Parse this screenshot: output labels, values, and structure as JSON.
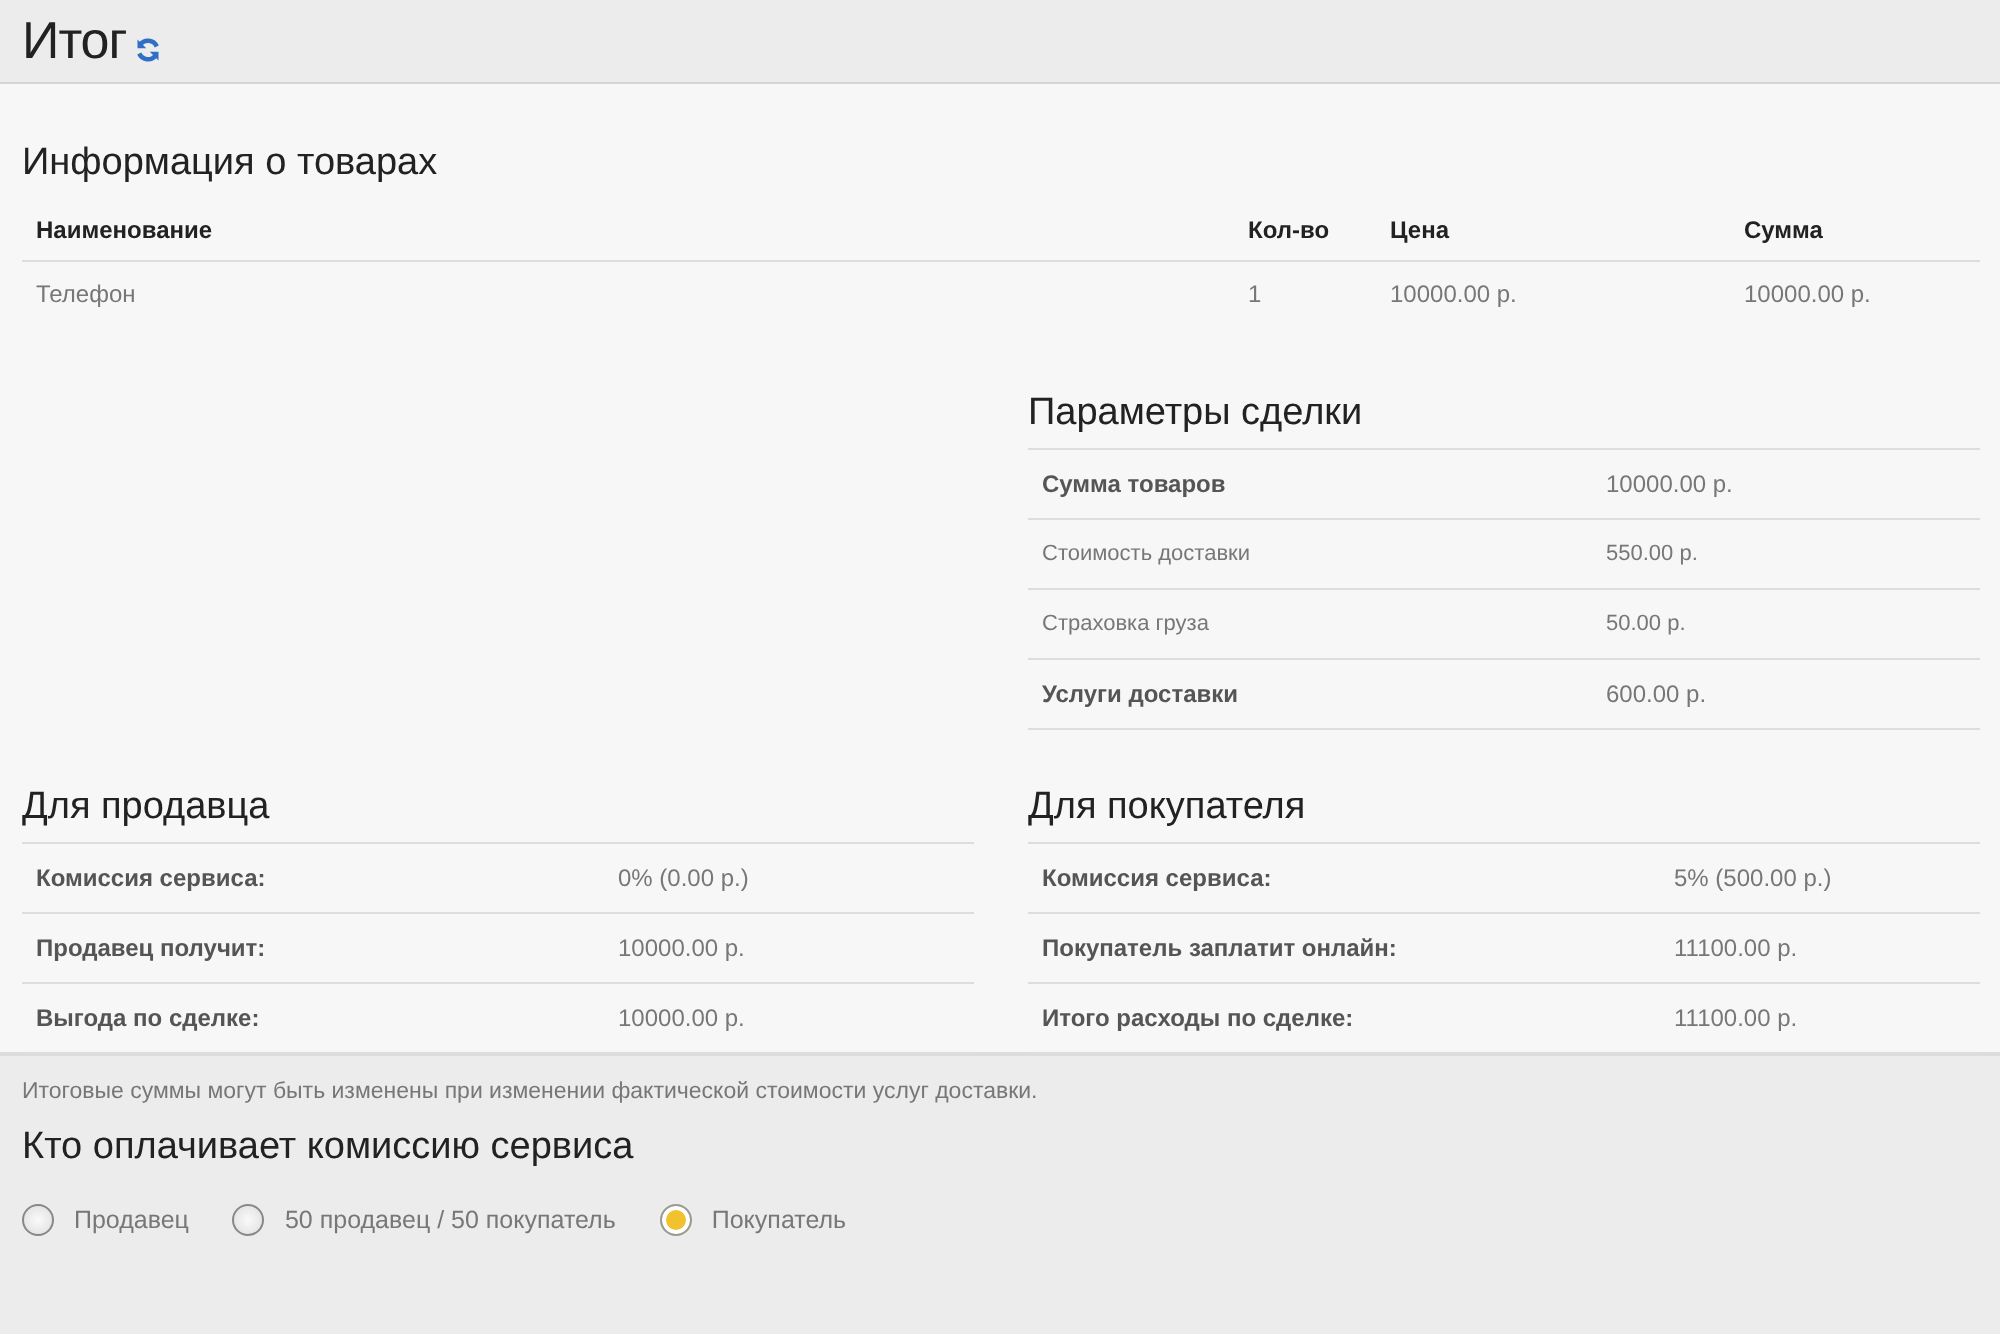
{
  "header": {
    "title": "Итог"
  },
  "products": {
    "title": "Информация о товарах",
    "columns": [
      "Наименование",
      "Кол-во",
      "Цена",
      "Сумма"
    ],
    "rows": [
      [
        "Телефон",
        "1",
        "10000.00 р.",
        "10000.00 р."
      ]
    ]
  },
  "deal": {
    "title": "Параметры сделки",
    "rows": [
      {
        "kind": "total",
        "label": "Сумма товаров",
        "value": "10000.00 р."
      },
      {
        "kind": "detail",
        "label": "Стоимость доставки",
        "value": "550.00 р."
      },
      {
        "kind": "detail",
        "label": "Страховка груза",
        "value": "50.00 р."
      },
      {
        "kind": "total",
        "label": "Услуги доставки",
        "value": "600.00 р."
      }
    ]
  },
  "seller": {
    "title": "Для продавца",
    "rows": [
      {
        "label": "Комиссия сервиса:",
        "value": "0% (0.00 р.)"
      },
      {
        "label": "Продавец получит:",
        "value": "10000.00 р."
      },
      {
        "label": "Выгода по сделке:",
        "value": "10000.00 р."
      }
    ]
  },
  "buyer": {
    "title": "Для покупателя",
    "rows": [
      {
        "label": "Комиссия сервиса:",
        "value": "5% (500.00 р.)"
      },
      {
        "label": "Покупатель заплатит онлайн:",
        "value": "11100.00 р."
      },
      {
        "label": "Итого расходы по сделке:",
        "value": "11100.00 р."
      }
    ]
  },
  "note": "Итоговые суммы могут быть изменены при изменении фактической стоимости услуг доставки.",
  "commission": {
    "title": "Кто оплачивает комиссию сервиса",
    "options": [
      {
        "label": "Продавец",
        "selected": false
      },
      {
        "label": "50 продавец / 50 покупатель",
        "selected": false
      },
      {
        "label": "Покупатель",
        "selected": true
      }
    ]
  }
}
